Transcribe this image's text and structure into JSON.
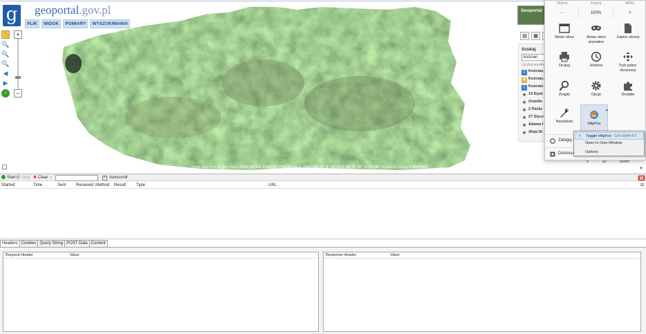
{
  "map": {
    "logo_letter": "g",
    "logo_main": "geoportal",
    "logo_domain": ".gov.pl",
    "menu": [
      "PLIK",
      "WIDOK",
      "POMIARY",
      "WYSZUKIWANIA"
    ],
    "zoom_plus": "+",
    "zoom_minus": "−",
    "coords": {
      "system": "Układ współrzędnych mapy",
      "epsg": "1992 [EPSG 2180]",
      "x": "X: 756049.50",
      "y": "Y: 1097349.25",
      "n": "N: 54°19'0.39\"",
      "e": "E: 20°11'53.96\"",
      "scale_label": "Aktualna Skala",
      "scale_value": "1:2000000"
    },
    "scale_ticks": [
      "0",
      "30",
      "60km"
    ]
  },
  "side_panel": {
    "thumb_label": "Geoportal",
    "search_title": "Szukaj",
    "search_value": "kościan",
    "result_count": "Liczba wyników",
    "results": [
      "Kościan,",
      "Kościan,",
      "Kościan",
      "14 Dywi",
      "Osiedle",
      "2 Paźdz",
      "27 Stycz",
      "Adama I",
      "Aleja St"
    ]
  },
  "firefox_menu": {
    "edit": [
      "Wytnij",
      "Kopiuj",
      "Wklej"
    ],
    "zoom": {
      "minus": "−",
      "level": "100%",
      "plus": "+"
    },
    "items": [
      {
        "label": "Nowe okno",
        "icon": "new-window-icon"
      },
      {
        "label": "Nowe okno prywatne",
        "icon": "private-mask-icon"
      },
      {
        "label": "Zapisz stronę",
        "icon": "save-page-icon"
      },
      {
        "label": "Drukuj",
        "icon": "print-icon"
      },
      {
        "label": "Historia",
        "icon": "history-clock-icon"
      },
      {
        "label": "Tryb pełno-ekranowy",
        "icon": "fullscreen-icon"
      },
      {
        "label": "Znajdź",
        "icon": "find-magnifier-icon"
      },
      {
        "label": "Opcje",
        "icon": "options-gear-icon"
      },
      {
        "label": "Dodatki",
        "icon": "addons-puzzle-icon"
      },
      {
        "label": "Narzędzia",
        "icon": "tools-wrench-icon"
      },
      {
        "label": "HttpFox",
        "icon": "httpfox-icon"
      }
    ],
    "sign_in": "Zaloguj s",
    "customize": "Dostosuj"
  },
  "httpfox_submenu": {
    "toggle": "Toggle HttpFox",
    "toggle_shortcut": "Ctrl+Shift+F2",
    "own_window": "Open In Own Window",
    "options": "Options"
  },
  "httpfox": {
    "start": "Start",
    "stop": "Stop",
    "clear": "Clear",
    "autoscroll": "Autoscroll",
    "columns": [
      "Started",
      "Time",
      "Sent",
      "Received",
      "Method",
      "Result",
      "Type",
      "URL"
    ],
    "tabs": [
      "Headers",
      "Cookies",
      "Query String",
      "POST Data",
      "Content"
    ],
    "request_header": "Request Header",
    "response_header": "Response Header",
    "value": "Value"
  },
  "colors": {
    "accent": "#1f5ca8",
    "start_green": "#2e9a2e",
    "stop_red": "#d23a2a"
  }
}
